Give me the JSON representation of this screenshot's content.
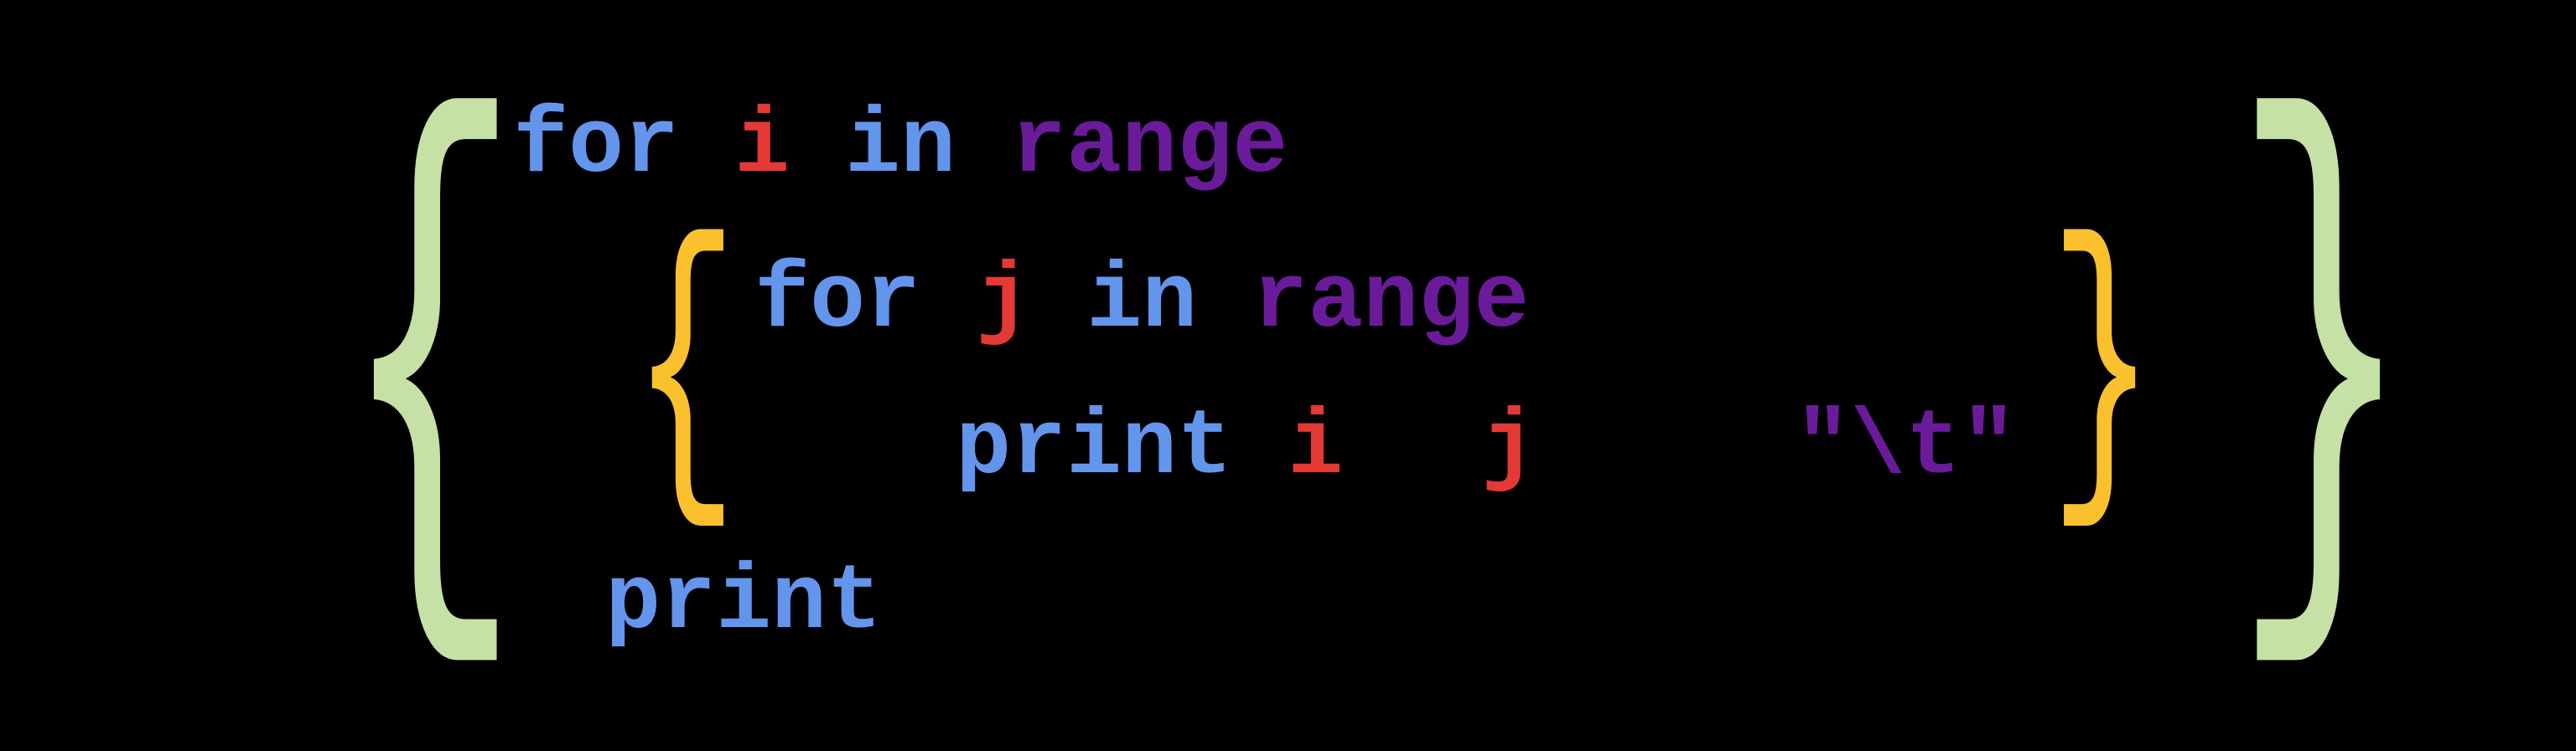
{
  "code": {
    "line1": {
      "keyword1": "for",
      "variable": "i",
      "keyword2": "in",
      "function": "range"
    },
    "line2": {
      "keyword1": "for",
      "variable": "j",
      "keyword2": "in",
      "function": "range"
    },
    "line3": {
      "function": "print",
      "var1": "i",
      "var2": "j",
      "string": "\"\\t\""
    },
    "line4": {
      "function": "print"
    }
  },
  "braces": {
    "outer_left": "{",
    "outer_right": "}",
    "inner_left": "{",
    "inner_right": "}"
  }
}
